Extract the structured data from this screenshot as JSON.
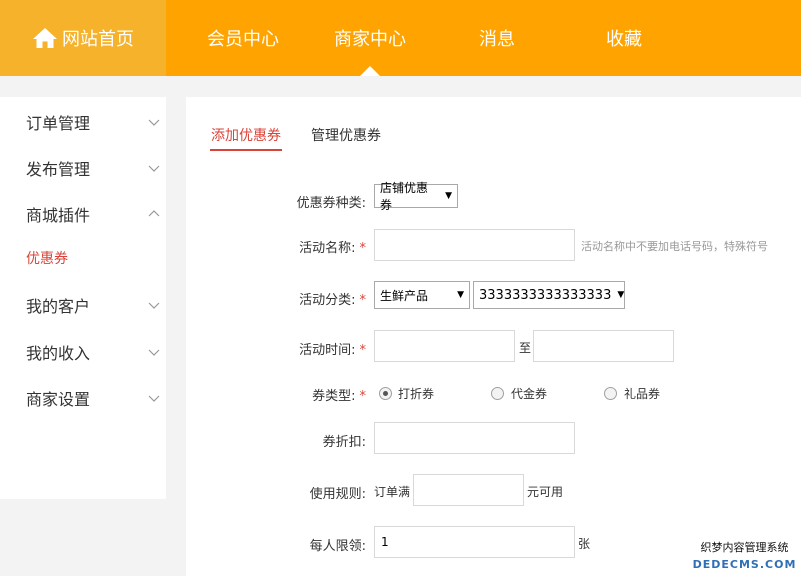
{
  "header": {
    "home_label": "网站首页",
    "nav": [
      "会员中心",
      "商家中心",
      "消息",
      "收藏"
    ]
  },
  "sidebar": {
    "items": [
      "订单管理",
      "发布管理",
      "商城插件",
      "我的客户",
      "我的收入",
      "商家设置"
    ],
    "sub_item": "优惠券"
  },
  "tabs": [
    "添加优惠券",
    "管理优惠券"
  ],
  "form": {
    "coupon_type_label": "优惠券种类:",
    "coupon_type_value": "店铺优惠券",
    "name_label": "活动名称:",
    "name_hint": "活动名称中不要加电话号码，特殊符号",
    "category_label": "活动分类:",
    "category_value": "生鲜产品",
    "subcategory_value": "3333333333333333",
    "time_label": "活动时间:",
    "time_sep": "至",
    "kind_label": "券类型:",
    "kind_options": [
      "打折券",
      "代金券",
      "礼品券"
    ],
    "discount_label": "券折扣:",
    "rule_label": "使用规则:",
    "rule_prefix": "订单满",
    "rule_suffix": "元可用",
    "limit_label": "每人限领:",
    "limit_value": "1",
    "limit_unit": "张",
    "required_mark": "*"
  },
  "watermark": {
    "line1": "织梦内容管理系统",
    "line2": "DEDECMS.COM"
  },
  "colors": {
    "nav": "#ffa300",
    "home": "#f6b22a",
    "accent": "#d9443a"
  }
}
